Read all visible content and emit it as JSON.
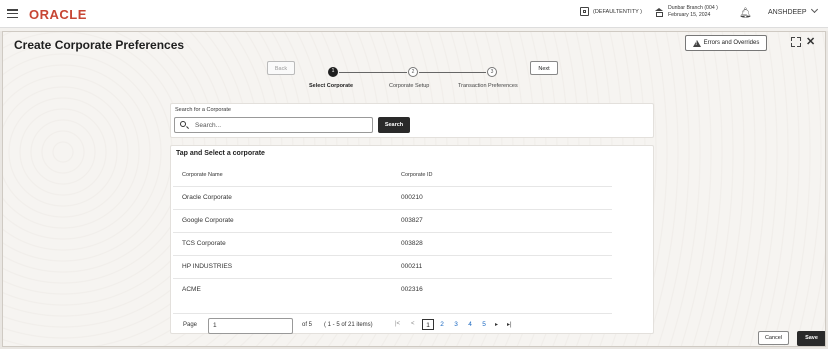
{
  "topbar": {
    "brand": "ORACLE",
    "entity": "(DEFAULTENTITY )",
    "branch_name": "Dunbar Branch (004 )",
    "branch_date": "February 15, 2024",
    "user": "ANSHDEEP",
    "brand_color": "#c74634",
    "icons": [
      "hamburger-icon",
      "entity-icon",
      "branch-icon",
      "bell-icon",
      "chevron-down-icon"
    ]
  },
  "modal": {
    "title": "Create Corporate Preferences",
    "errors_label": "Errors and Overrides",
    "icons": [
      "warning-icon",
      "expand-icon",
      "close-icon"
    ]
  },
  "wizard": {
    "back_label": "Back",
    "next_label": "Next",
    "steps": [
      {
        "num": "1",
        "label": "Select Corporate",
        "active": true
      },
      {
        "num": "2",
        "label": "Corporate Setup",
        "active": false
      },
      {
        "num": "3",
        "label": "Transaction Preferences",
        "active": false
      }
    ]
  },
  "search": {
    "label": "Search for a Corporate",
    "placeholder": "Search...",
    "value": "",
    "button_label": "Search"
  },
  "table": {
    "title": "Tap and Select a corporate",
    "columns": [
      "Corporate Name",
      "Corporate ID"
    ],
    "rows": [
      {
        "name": "Oracle Corporate",
        "id": "000210"
      },
      {
        "name": "Google Corporate",
        "id": "003827"
      },
      {
        "name": "TCS Corporate",
        "id": "003828"
      },
      {
        "name": "HP INDUSTRIES",
        "id": "000211"
      },
      {
        "name": "ACME",
        "id": "002316"
      }
    ]
  },
  "pagination": {
    "page_label": "Page",
    "page_value": "1",
    "of_label": "of 5",
    "items_label": "( 1 - 5 of 21 items)",
    "pages": [
      "1",
      "2",
      "3",
      "4",
      "5"
    ],
    "current_page": "1",
    "first_symbol": "|<",
    "prev_symbol": "<",
    "next_symbol": "▸",
    "last_symbol": "▸|"
  },
  "footer": {
    "cancel_label": "Cancel",
    "save_label": "Save"
  }
}
